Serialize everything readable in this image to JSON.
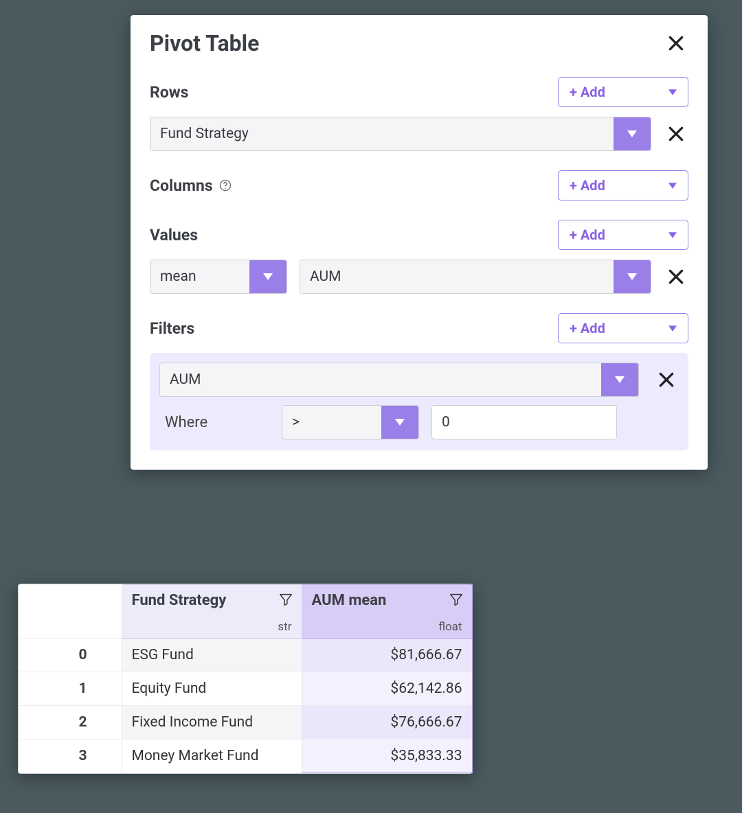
{
  "panel": {
    "title": "Pivot Table",
    "add_label": "+ Add",
    "sections": {
      "rows": {
        "label": "Rows",
        "items": [
          {
            "field": "Fund Strategy"
          }
        ]
      },
      "columns": {
        "label": "Columns",
        "items": []
      },
      "values": {
        "label": "Values",
        "items": [
          {
            "agg": "mean",
            "field": "AUM"
          }
        ]
      },
      "filters": {
        "label": "Filters",
        "where_label": "Where",
        "items": [
          {
            "field": "AUM",
            "op": ">",
            "value": "0"
          }
        ]
      }
    }
  },
  "result": {
    "columns": [
      {
        "name": "Fund Strategy",
        "dtype": "str"
      },
      {
        "name": "AUM mean",
        "dtype": "float"
      }
    ],
    "rows": [
      {
        "idx": "0",
        "strategy": "ESG Fund",
        "aum_mean": "$81,666.67"
      },
      {
        "idx": "1",
        "strategy": "Equity Fund",
        "aum_mean": "$62,142.86"
      },
      {
        "idx": "2",
        "strategy": "Fixed Income Fund",
        "aum_mean": "$76,666.67"
      },
      {
        "idx": "3",
        "strategy": "Money Market Fund",
        "aum_mean": "$35,833.33"
      }
    ]
  }
}
